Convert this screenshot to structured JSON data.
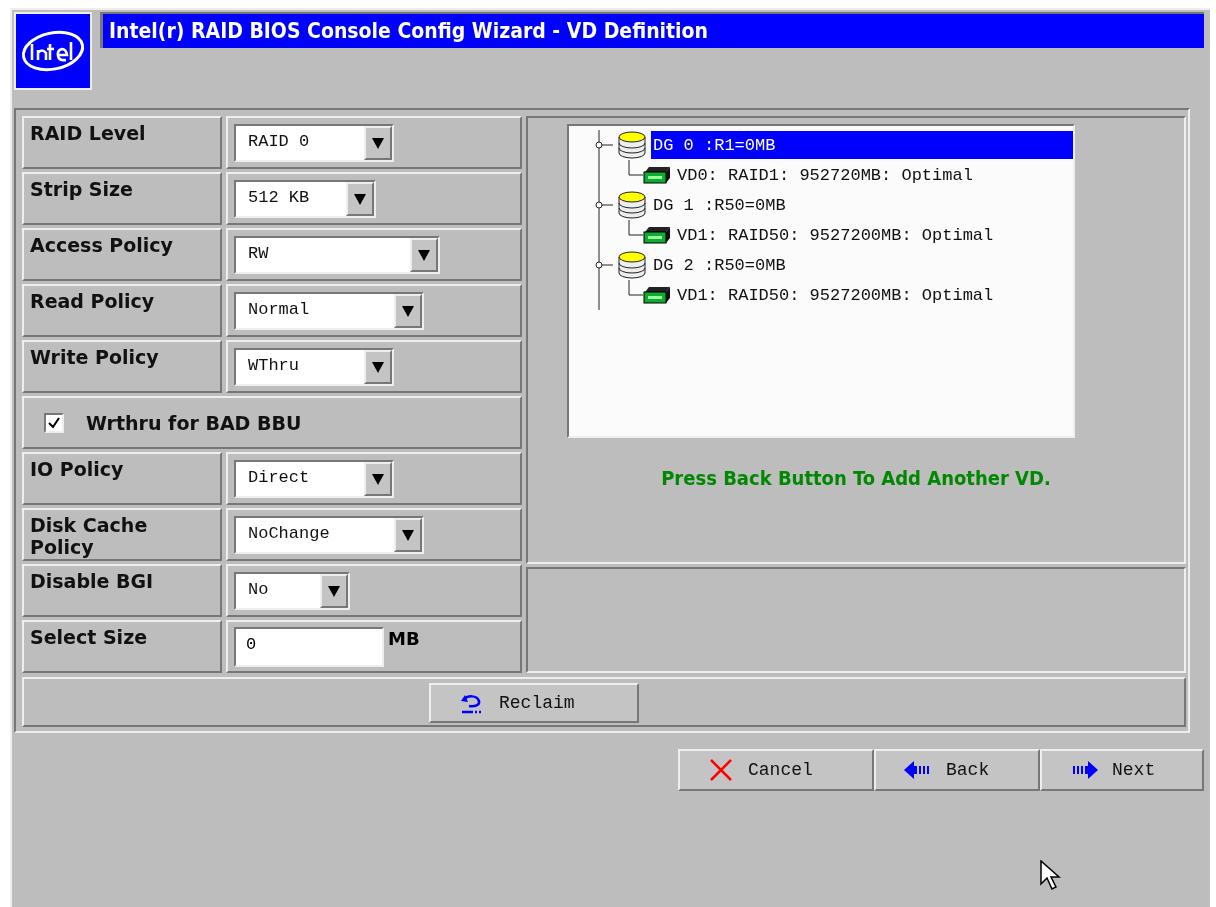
{
  "window": {
    "title": "Intel(r) RAID BIOS Console Config Wizard - VD Definition"
  },
  "settings": [
    {
      "kind": "dropdown",
      "label": "RAID Level",
      "value": "RAID 0"
    },
    {
      "kind": "dropdown",
      "label": "Strip Size",
      "value": "512 KB"
    },
    {
      "kind": "dropdown",
      "label": "Access Policy",
      "value": "RW"
    },
    {
      "kind": "dropdown",
      "label": "Read Policy",
      "value": "Normal"
    },
    {
      "kind": "dropdown",
      "label": "Write Policy",
      "value": "WThru"
    },
    {
      "kind": "checkbox",
      "label": "Wrthru for BAD BBU",
      "checked": true
    },
    {
      "kind": "dropdown",
      "label": "IO Policy",
      "value": "Direct"
    },
    {
      "kind": "dropdown",
      "label": "Disk Cache Policy",
      "value": "NoChange"
    },
    {
      "kind": "dropdown",
      "label": "Disable BGI",
      "value": "No"
    },
    {
      "kind": "size",
      "label": "Select Size",
      "value": "0",
      "unit": "MB"
    }
  ],
  "tree": [
    {
      "label": "DG 0 :R1=0MB",
      "selected": true,
      "children": [
        {
          "label": "VD0: RAID1: 952720MB: Optimal",
          "selected": false
        }
      ]
    },
    {
      "label": "DG 1 :R50=0MB",
      "selected": false,
      "children": [
        {
          "label": "VD1: RAID50: 9527200MB: Optimal",
          "selected": false
        }
      ]
    },
    {
      "label": "DG 2 :R50=0MB",
      "selected": false,
      "children": [
        {
          "label": "VD1: RAID50: 9527200MB: Optimal",
          "selected": false
        }
      ]
    }
  ],
  "hint": "Press Back Button To Add Another VD.",
  "reclaim_button": "Reclaim",
  "buttons": [
    {
      "label": "Cancel",
      "kind": "cancel"
    },
    {
      "label": "Back",
      "kind": "back"
    },
    {
      "label": "Next",
      "kind": "next"
    }
  ]
}
